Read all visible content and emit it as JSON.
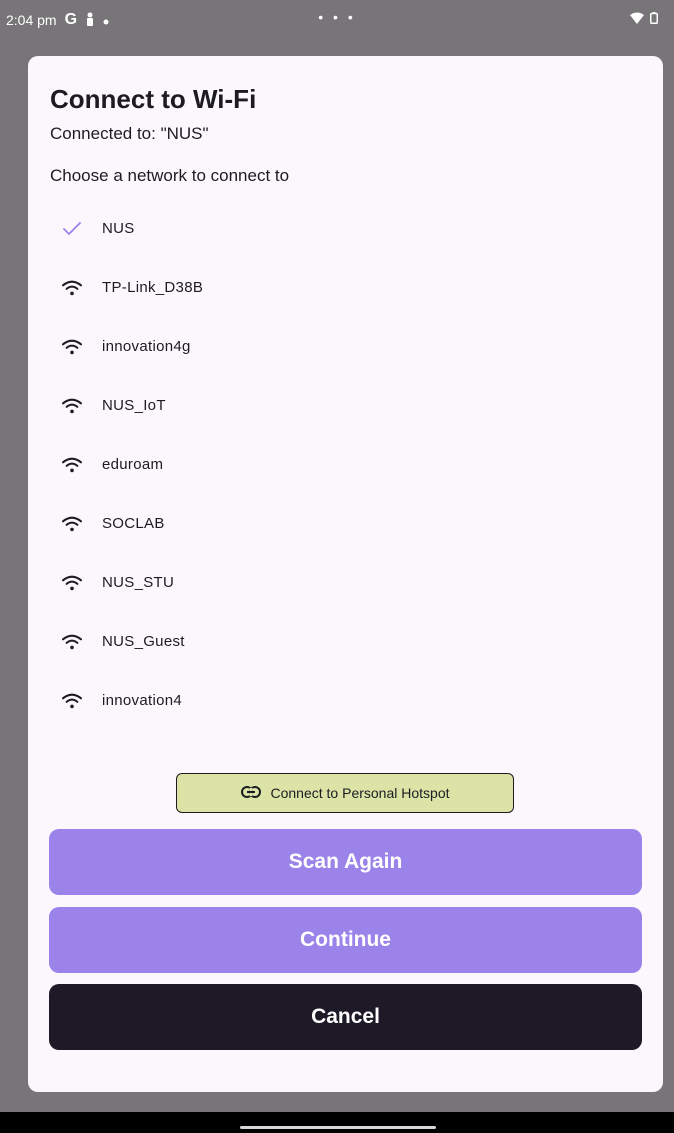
{
  "status_bar": {
    "time": "2:04 pm",
    "g_label": "G",
    "dots": "• • •"
  },
  "dialog": {
    "title": "Connect to Wi-Fi",
    "connected_text": "Connected to: \"NUS\"",
    "choose_text": "Choose a network to connect to",
    "networks": [
      {
        "name": "NUS",
        "icon": "check-icon",
        "selected": true
      },
      {
        "name": "TP-Link_D38B",
        "icon": "wifi-icon"
      },
      {
        "name": "innovation4g",
        "icon": "wifi-icon"
      },
      {
        "name": "NUS_IoT",
        "icon": "wifi-icon"
      },
      {
        "name": "eduroam",
        "icon": "wifi-icon"
      },
      {
        "name": "SOCLAB",
        "icon": "wifi-icon"
      },
      {
        "name": "NUS_STU",
        "icon": "wifi-icon"
      },
      {
        "name": "NUS_Guest",
        "icon": "wifi-icon"
      },
      {
        "name": "innovation4",
        "icon": "wifi-icon"
      }
    ],
    "hotspot_label": "Connect to Personal Hotspot",
    "scan_label": "Scan Again",
    "continue_label": "Continue",
    "cancel_label": "Cancel"
  },
  "colors": {
    "accent": "#9b83e9",
    "check": "#9b83e9",
    "hotspot_bg": "#dbe4a6",
    "cancel_bg": "#1d1926"
  }
}
